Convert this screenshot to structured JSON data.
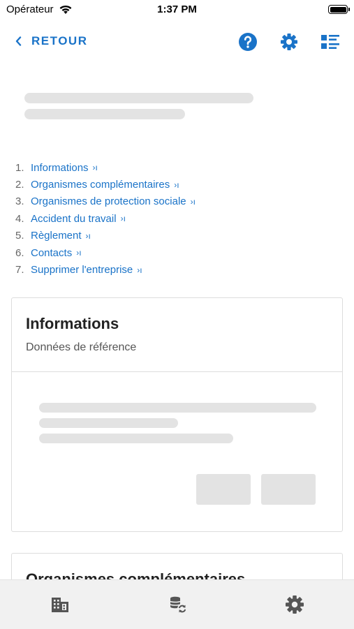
{
  "status_bar": {
    "carrier": "Opérateur",
    "time": "1:37 PM"
  },
  "nav": {
    "back_label": "RETOUR",
    "icons": [
      "chevron-left-icon",
      "help-icon",
      "settings-icon",
      "list-view-icon"
    ],
    "accent_color": "#1a73c8"
  },
  "toc": {
    "items": [
      {
        "number": "1.",
        "label": "Informations"
      },
      {
        "number": "2.",
        "label": "Organismes complémentaires"
      },
      {
        "number": "3.",
        "label": "Organismes de protection sociale"
      },
      {
        "number": "4.",
        "label": "Accident du travail"
      },
      {
        "number": "5.",
        "label": "Règlement"
      },
      {
        "number": "6.",
        "label": "Contacts"
      },
      {
        "number": "7.",
        "label": "Supprimer l'entreprise"
      }
    ],
    "chevron_glyph": "›ı"
  },
  "cards": [
    {
      "title": "Informations",
      "subtitle": "Données de référence"
    },
    {
      "title": "Organismes complémentaires"
    }
  ],
  "tab_bar": {
    "icons": [
      "building-icon",
      "database-sync-icon",
      "settings-icon"
    ]
  }
}
